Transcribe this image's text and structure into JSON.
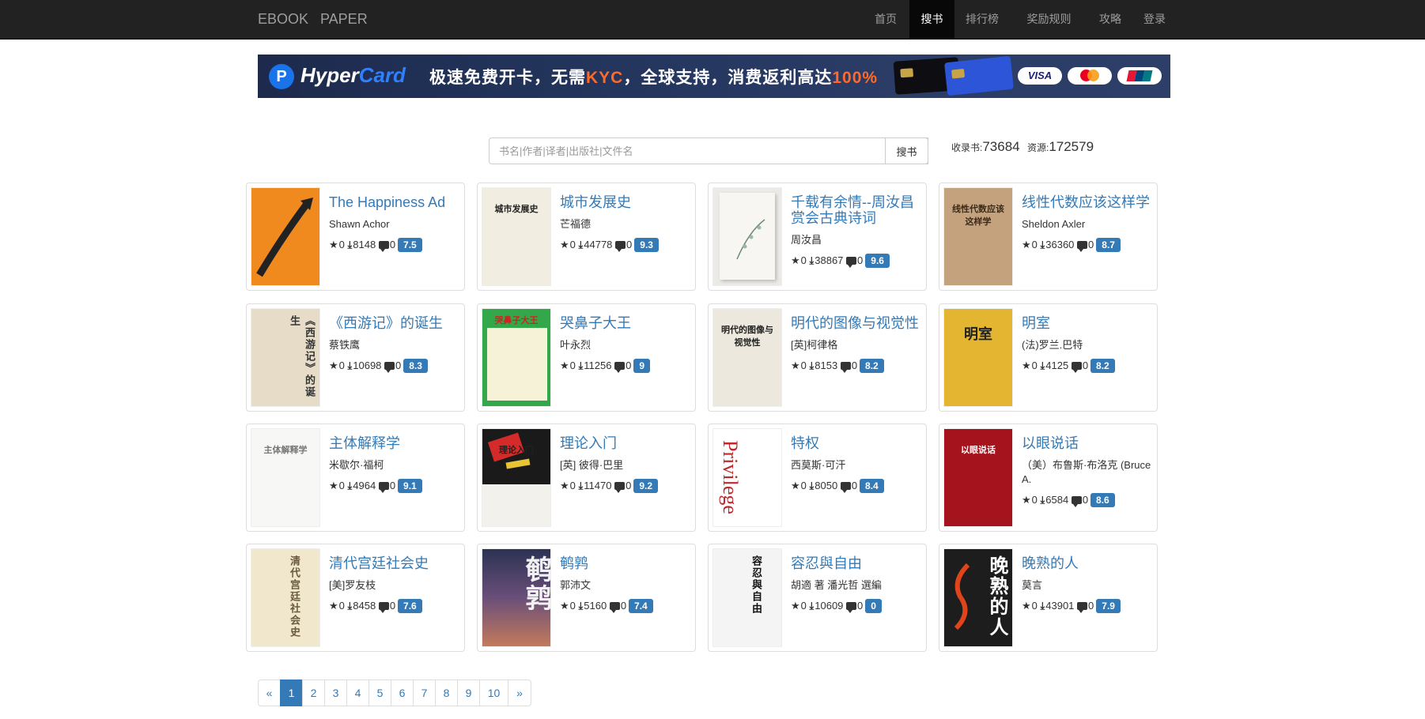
{
  "nav": {
    "brand1": "EBOOK",
    "brand2": "PAPER",
    "items": [
      "首页",
      "搜书",
      "排行榜",
      "奖励规则",
      "攻略",
      "登录"
    ]
  },
  "banner": {
    "logo_p": "P",
    "name1": "Hyper",
    "name2": "Card",
    "text1": "极速免费开卡，无需",
    "text_kyc": "KYC",
    "text2": "，全球支持，消费返利高达",
    "text_pct": "100%",
    "visa": "VISA"
  },
  "search": {
    "placeholder": "书名|作者|译者|出版社|文件名",
    "button": "搜书",
    "books_label": "收录书:",
    "books_count": "73684",
    "res_label": "资源:",
    "res_count": "172579"
  },
  "books": [
    {
      "title": "The Happiness Ad",
      "author": "Shawn Achor",
      "stars": "0",
      "downloads": "8148",
      "comments": "0",
      "score": "7.5"
    },
    {
      "title": "城市发展史",
      "author": "芒福德",
      "stars": "0",
      "downloads": "44778",
      "comments": "0",
      "score": "9.3"
    },
    {
      "title": "千载有余情--周汝昌赏会古典诗词",
      "author": "周汝昌",
      "stars": "0",
      "downloads": "38867",
      "comments": "0",
      "score": "9.6"
    },
    {
      "title": "线性代数应该这样学",
      "author": "Sheldon Axler",
      "stars": "0",
      "downloads": "36360",
      "comments": "0",
      "score": "8.7"
    },
    {
      "title": "《西游记》的诞生",
      "author": "蔡铁鹰",
      "stars": "0",
      "downloads": "10698",
      "comments": "0",
      "score": "8.3"
    },
    {
      "title": "哭鼻子大王",
      "author": "叶永烈",
      "stars": "0",
      "downloads": "11256",
      "comments": "0",
      "score": "9"
    },
    {
      "title": "明代的图像与视觉性",
      "author": "[英]柯律格",
      "stars": "0",
      "downloads": "8153",
      "comments": "0",
      "score": "8.2"
    },
    {
      "title": "明室",
      "author": "(法)罗兰.巴特",
      "stars": "0",
      "downloads": "4125",
      "comments": "0",
      "score": "8.2"
    },
    {
      "title": "主体解释学",
      "author": "米歇尔·福柯",
      "stars": "0",
      "downloads": "4964",
      "comments": "0",
      "score": "9.1"
    },
    {
      "title": "理论入门",
      "author": "[英] 彼得·巴里",
      "stars": "0",
      "downloads": "11470",
      "comments": "0",
      "score": "9.2"
    },
    {
      "title": "特权",
      "author": "西莫斯·可汗",
      "stars": "0",
      "downloads": "8050",
      "comments": "0",
      "score": "8.4"
    },
    {
      "title": "以眼说话",
      "author": "（美）布鲁斯·布洛克 (Bruce A.",
      "stars": "0",
      "downloads": "6584",
      "comments": "0",
      "score": "8.6"
    },
    {
      "title": "清代宫廷社会史",
      "author": "[美]罗友枝",
      "stars": "0",
      "downloads": "8458",
      "comments": "0",
      "score": "7.6"
    },
    {
      "title": "鹌鹑",
      "author": "郭沛文",
      "stars": "0",
      "downloads": "5160",
      "comments": "0",
      "score": "7.4"
    },
    {
      "title": "容忍與自由",
      "author": "胡適 著 潘光哲 選編",
      "stars": "0",
      "downloads": "10609",
      "comments": "0",
      "score": "0"
    },
    {
      "title": "晚熟的人",
      "author": "莫言",
      "stars": "0",
      "downloads": "43901",
      "comments": "0",
      "score": "7.9"
    }
  ],
  "covers": [
    {
      "bg": "#f08a1e",
      "text": "",
      "fg": "#fff"
    },
    {
      "bg": "#f1ede0",
      "text": "城市发展史",
      "fg": "#222"
    },
    {
      "bg": "#eceae6",
      "text": "",
      "fg": "#666"
    },
    {
      "bg": "#c4a27e",
      "text": "线性代数应该这样学",
      "fg": "#3b2a1a"
    },
    {
      "bg": "#e7dcc8",
      "text": "《西游记》的诞生",
      "fg": "#333"
    },
    {
      "bg": "#32a84a",
      "text": "哭鼻子大王",
      "fg": "#d61f1f"
    },
    {
      "bg": "#ede8dd",
      "text": "明代的图像与视觉性",
      "fg": "#222"
    },
    {
      "bg": "#e3b531",
      "text": "明室",
      "fg": "#222"
    },
    {
      "bg": "#f7f7f5",
      "text": "主体解释学",
      "fg": "#777"
    },
    {
      "bg": "#f3f1ec",
      "text": "理论入门",
      "fg": "#222"
    },
    {
      "bg": "#ffffff",
      "text": "Privilege",
      "fg": "#c1272d"
    },
    {
      "bg": "#a5131c",
      "text": "以眼说话",
      "fg": "#fff"
    },
    {
      "bg": "#f1e7cc",
      "text": "清代宫廷社会史",
      "fg": "#6b5b3e"
    },
    {
      "bg": "#3b3f55",
      "text": "鹌鹑",
      "fg": "#f1f1f1"
    },
    {
      "bg": "#f4f4f4",
      "text": "容忍與自由",
      "fg": "#111"
    },
    {
      "bg": "#1d1d1d",
      "text": "晚熟的人",
      "fg": "#fff"
    }
  ],
  "pagination": [
    "«",
    "1",
    "2",
    "3",
    "4",
    "5",
    "6",
    "7",
    "8",
    "9",
    "10",
    "»"
  ],
  "pagination_active": "1"
}
